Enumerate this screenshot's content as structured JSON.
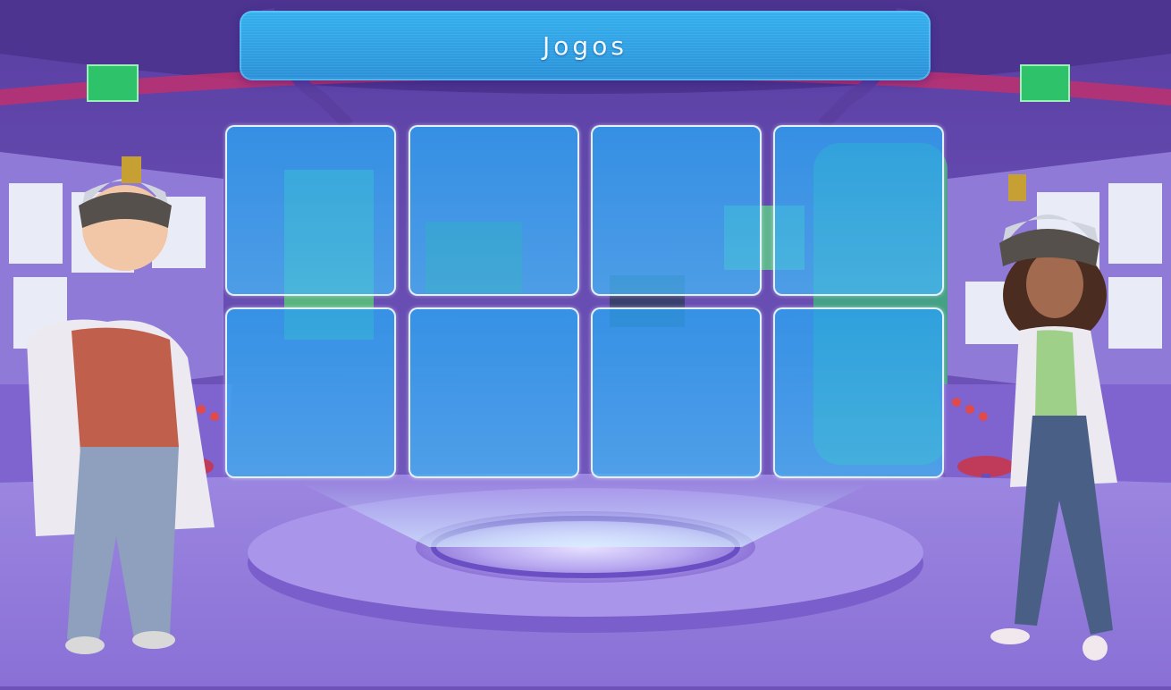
{
  "header": {
    "title": "Jogos"
  },
  "game_grid": {
    "rows": 2,
    "columns": 4,
    "tile_count": 8
  },
  "colors": {
    "room_purple": "#6f52b8",
    "title_blue": "#35b0ee",
    "tile_blue": "#2ca0f0",
    "tile_border": "#ebf5ff"
  }
}
